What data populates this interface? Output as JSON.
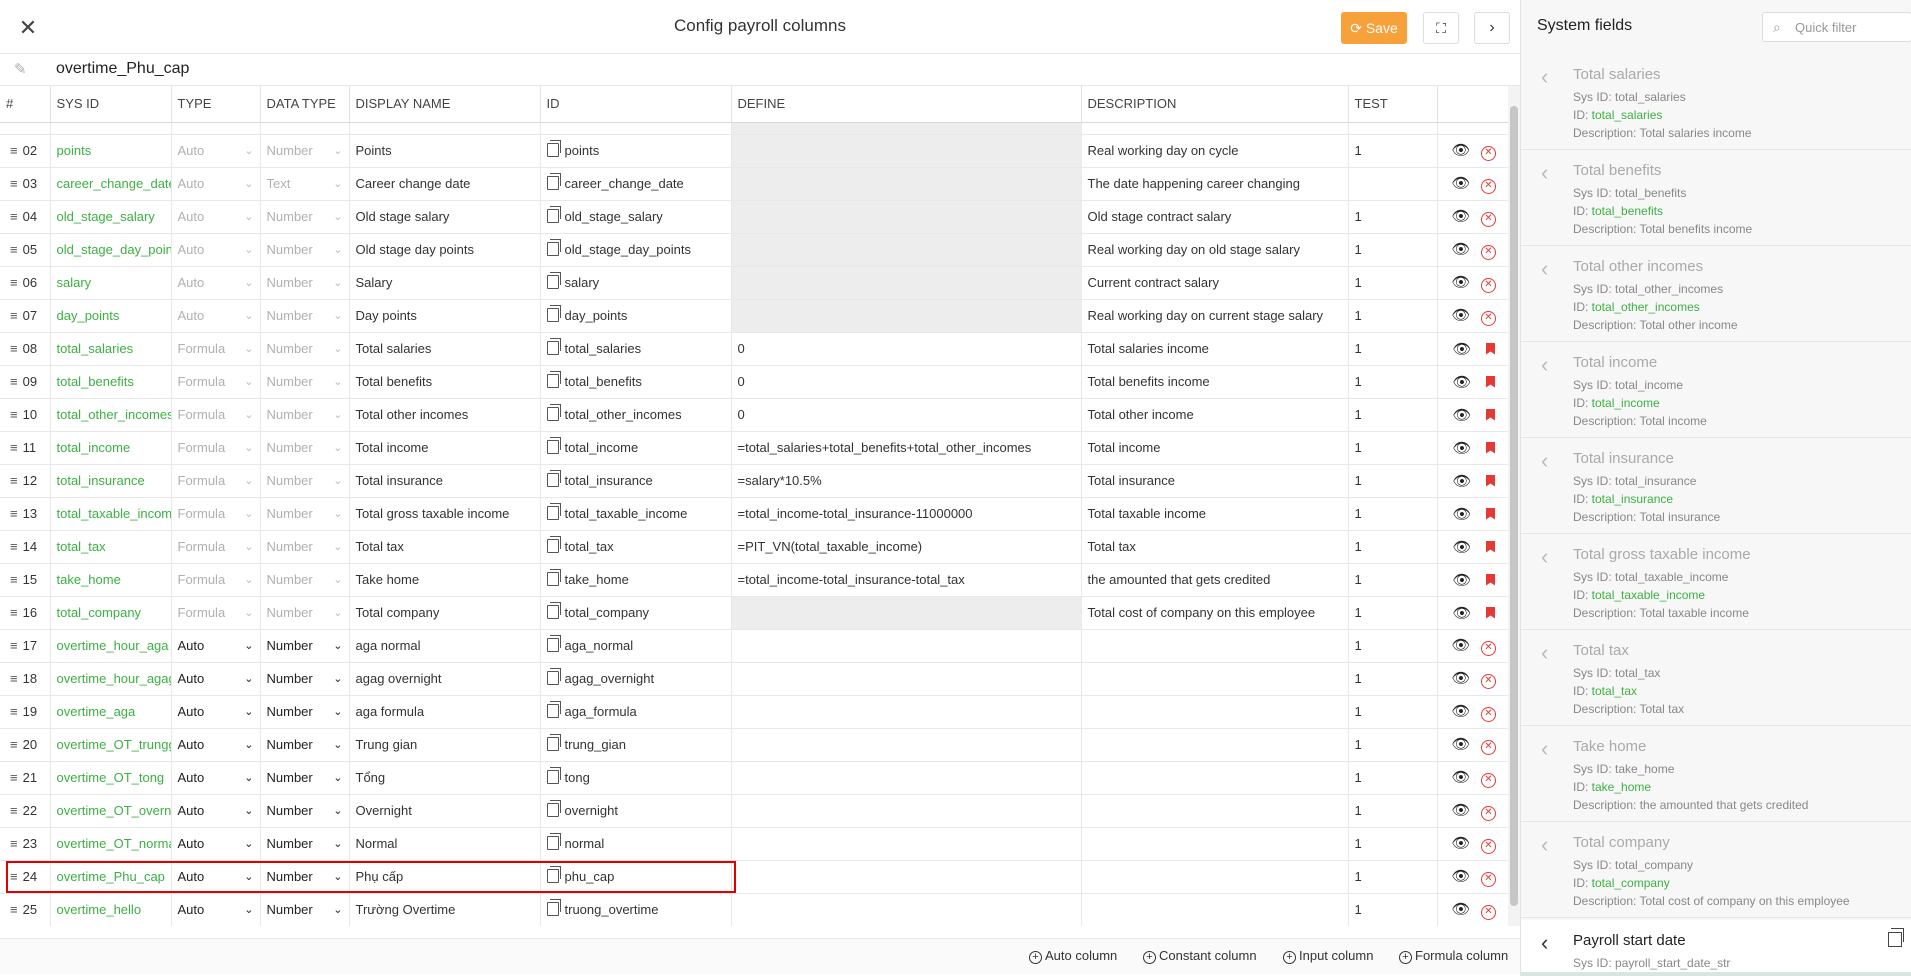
{
  "header": {
    "title": "Config payroll columns",
    "save_label": "Save",
    "expand_icon": "⛶",
    "next_icon": "›",
    "close_icon": "✕"
  },
  "name_row": {
    "value": "overtime_Phu_cap"
  },
  "columns": [
    "#",
    "SYS ID",
    "TYPE",
    "DATA TYPE",
    "DISPLAY NAME",
    "ID",
    "DEFINE",
    "DESCRIPTION",
    "TEST"
  ],
  "rows": [
    {
      "num": "02",
      "sys_id": "points",
      "type": "Auto",
      "data_type": "Number",
      "display_name": "Points",
      "id": "points",
      "define": "",
      "description": "Real working day on cycle",
      "test": "1",
      "locked": true,
      "action": "delete"
    },
    {
      "num": "03",
      "sys_id": "career_change_date_",
      "type": "Auto",
      "data_type": "Text",
      "display_name": "Career change date",
      "id": "career_change_date",
      "define": "",
      "description": "The date happening career changing",
      "test": "",
      "locked": true,
      "action": "delete"
    },
    {
      "num": "04",
      "sys_id": "old_stage_salary",
      "type": "Auto",
      "data_type": "Number",
      "display_name": "Old stage salary",
      "id": "old_stage_salary",
      "define": "",
      "description": "Old stage contract salary",
      "test": "1",
      "locked": true,
      "action": "delete"
    },
    {
      "num": "05",
      "sys_id": "old_stage_day_points",
      "type": "Auto",
      "data_type": "Number",
      "display_name": "Old stage day points",
      "id": "old_stage_day_points",
      "define": "",
      "description": "Real working day on old stage salary",
      "test": "1",
      "locked": true,
      "action": "delete"
    },
    {
      "num": "06",
      "sys_id": "salary",
      "type": "Auto",
      "data_type": "Number",
      "display_name": "Salary",
      "id": "salary",
      "define": "",
      "description": "Current contract salary",
      "test": "1",
      "locked": true,
      "action": "delete"
    },
    {
      "num": "07",
      "sys_id": "day_points",
      "type": "Auto",
      "data_type": "Number",
      "display_name": "Day points",
      "id": "day_points",
      "define": "",
      "description": "Real working day on current stage salary",
      "test": "1",
      "locked": true,
      "action": "delete"
    },
    {
      "num": "08",
      "sys_id": "total_salaries",
      "type": "Formula",
      "data_type": "Number",
      "display_name": "Total salaries",
      "id": "total_salaries",
      "define": "0",
      "description": "Total salaries income",
      "test": "1",
      "locked": true,
      "action": "flag"
    },
    {
      "num": "09",
      "sys_id": "total_benefits",
      "type": "Formula",
      "data_type": "Number",
      "display_name": "Total benefits",
      "id": "total_benefits",
      "define": "0",
      "description": "Total benefits income",
      "test": "1",
      "locked": true,
      "action": "flag"
    },
    {
      "num": "10",
      "sys_id": "total_other_incomes",
      "type": "Formula",
      "data_type": "Number",
      "display_name": "Total other incomes",
      "id": "total_other_incomes",
      "define": "0",
      "description": "Total other income",
      "test": "1",
      "locked": true,
      "action": "flag"
    },
    {
      "num": "11",
      "sys_id": "total_income",
      "type": "Formula",
      "data_type": "Number",
      "display_name": "Total income",
      "id": "total_income",
      "define": "=total_salaries+total_benefits+total_other_incomes",
      "description": "Total income",
      "test": "1",
      "locked": true,
      "action": "flag"
    },
    {
      "num": "12",
      "sys_id": "total_insurance",
      "type": "Formula",
      "data_type": "Number",
      "display_name": "Total insurance",
      "id": "total_insurance",
      "define": "=salary*10.5%",
      "description": "Total insurance",
      "test": "1",
      "locked": true,
      "action": "flag"
    },
    {
      "num": "13",
      "sys_id": "total_taxable_income",
      "type": "Formula",
      "data_type": "Number",
      "display_name": "Total gross taxable income",
      "id": "total_taxable_income",
      "define": "=total_income-total_insurance-11000000",
      "description": "Total taxable income",
      "test": "1",
      "locked": true,
      "action": "flag"
    },
    {
      "num": "14",
      "sys_id": "total_tax",
      "type": "Formula",
      "data_type": "Number",
      "display_name": "Total tax",
      "id": "total_tax",
      "define": "=PIT_VN(total_taxable_income)",
      "description": "Total tax",
      "test": "1",
      "locked": true,
      "action": "flag"
    },
    {
      "num": "15",
      "sys_id": "take_home",
      "type": "Formula",
      "data_type": "Number",
      "display_name": "Take home",
      "id": "take_home",
      "define": "=total_income-total_insurance-total_tax",
      "description": "the amounted that gets credited",
      "test": "1",
      "locked": true,
      "action": "flag"
    },
    {
      "num": "16",
      "sys_id": "total_company",
      "type": "Formula",
      "data_type": "Number",
      "display_name": "Total company",
      "id": "total_company",
      "define": "",
      "description": "Total cost of company on this employee",
      "test": "1",
      "locked": true,
      "action": "flag"
    },
    {
      "num": "17",
      "sys_id": "overtime_hour_aga",
      "type": "Auto",
      "data_type": "Number",
      "display_name": "aga normal",
      "id": "aga_normal",
      "define": "",
      "description": "",
      "test": "1",
      "locked": false,
      "action": "delete"
    },
    {
      "num": "18",
      "sys_id": "overtime_hour_agag",
      "type": "Auto",
      "data_type": "Number",
      "display_name": "agag overnight",
      "id": "agag_overnight",
      "define": "",
      "description": "",
      "test": "1",
      "locked": false,
      "action": "delete"
    },
    {
      "num": "19",
      "sys_id": "overtime_aga",
      "type": "Auto",
      "data_type": "Number",
      "display_name": "aga formula",
      "id": "aga_formula",
      "define": "",
      "description": "",
      "test": "1",
      "locked": false,
      "action": "delete"
    },
    {
      "num": "20",
      "sys_id": "overtime_OT_trunggi",
      "type": "Auto",
      "data_type": "Number",
      "display_name": "Trung gian",
      "id": "trung_gian",
      "define": "",
      "description": "",
      "test": "1",
      "locked": false,
      "action": "delete"
    },
    {
      "num": "21",
      "sys_id": "overtime_OT_tong",
      "type": "Auto",
      "data_type": "Number",
      "display_name": "Tổng",
      "id": "tong",
      "define": "",
      "description": "",
      "test": "1",
      "locked": false,
      "action": "delete"
    },
    {
      "num": "22",
      "sys_id": "overtime_OT_overnig",
      "type": "Auto",
      "data_type": "Number",
      "display_name": "Overnight",
      "id": "overnight",
      "define": "",
      "description": "",
      "test": "1",
      "locked": false,
      "action": "delete"
    },
    {
      "num": "23",
      "sys_id": "overtime_OT_normal",
      "type": "Auto",
      "data_type": "Number",
      "display_name": "Normal",
      "id": "normal",
      "define": "",
      "description": "",
      "test": "1",
      "locked": false,
      "action": "delete"
    },
    {
      "num": "24",
      "sys_id": "overtime_Phu_cap",
      "type": "Auto",
      "data_type": "Number",
      "display_name": "Phụ cấp",
      "id": "phu_cap",
      "define": "",
      "description": "",
      "test": "1",
      "locked": false,
      "action": "delete"
    },
    {
      "num": "25",
      "sys_id": "overtime_hello",
      "type": "Auto",
      "data_type": "Number",
      "display_name": "Trường Overtime",
      "id": "truong_overtime",
      "define": "",
      "description": "",
      "test": "1",
      "locked": false,
      "action": "delete"
    }
  ],
  "bottom_bar": {
    "auto": "Auto column",
    "constant": "Constant column",
    "input": "Input column",
    "formula": "Formula column"
  },
  "panel": {
    "title": "System fields",
    "filter_placeholder": "Quick filter",
    "fields": [
      {
        "name": "Total salaries",
        "sys_id": "Sys ID: total_salaries",
        "id_label": "ID: ",
        "id": "total_salaries",
        "description": "Description: Total salaries income"
      },
      {
        "name": "Total benefits",
        "sys_id": "Sys ID: total_benefits",
        "id_label": "ID: ",
        "id": "total_benefits",
        "description": "Description: Total benefits income"
      },
      {
        "name": "Total other incomes",
        "sys_id": "Sys ID: total_other_incomes",
        "id_label": "ID: ",
        "id": "total_other_incomes",
        "description": "Description: Total other income"
      },
      {
        "name": "Total income",
        "sys_id": "Sys ID: total_income",
        "id_label": "ID: ",
        "id": "total_income",
        "description": "Description: Total income"
      },
      {
        "name": "Total insurance",
        "sys_id": "Sys ID: total_insurance",
        "id_label": "ID: ",
        "id": "total_insurance",
        "description": "Description: Total insurance"
      },
      {
        "name": "Total gross taxable income",
        "sys_id": "Sys ID: total_taxable_income",
        "id_label": "ID: ",
        "id": "total_taxable_income",
        "description": "Description: Total taxable income"
      },
      {
        "name": "Total tax",
        "sys_id": "Sys ID: total_tax",
        "id_label": "ID: ",
        "id": "total_tax",
        "description": "Description: Total tax"
      },
      {
        "name": "Take home",
        "sys_id": "Sys ID: take_home",
        "id_label": "ID: ",
        "id": "take_home",
        "description": "Description: the amounted that gets credited"
      },
      {
        "name": "Total company",
        "sys_id": "Sys ID: total_company",
        "id_label": "ID: ",
        "id": "total_company",
        "description": "Description: Total cost of company on this employee"
      }
    ],
    "active_field": {
      "name": "Payroll start date",
      "sys_id": "Sys ID: payroll_start_date_str"
    }
  },
  "colors": {
    "accent": "#f7a13a",
    "green": "#3cb043",
    "danger": "#e53935",
    "highlight": "#e00000"
  }
}
